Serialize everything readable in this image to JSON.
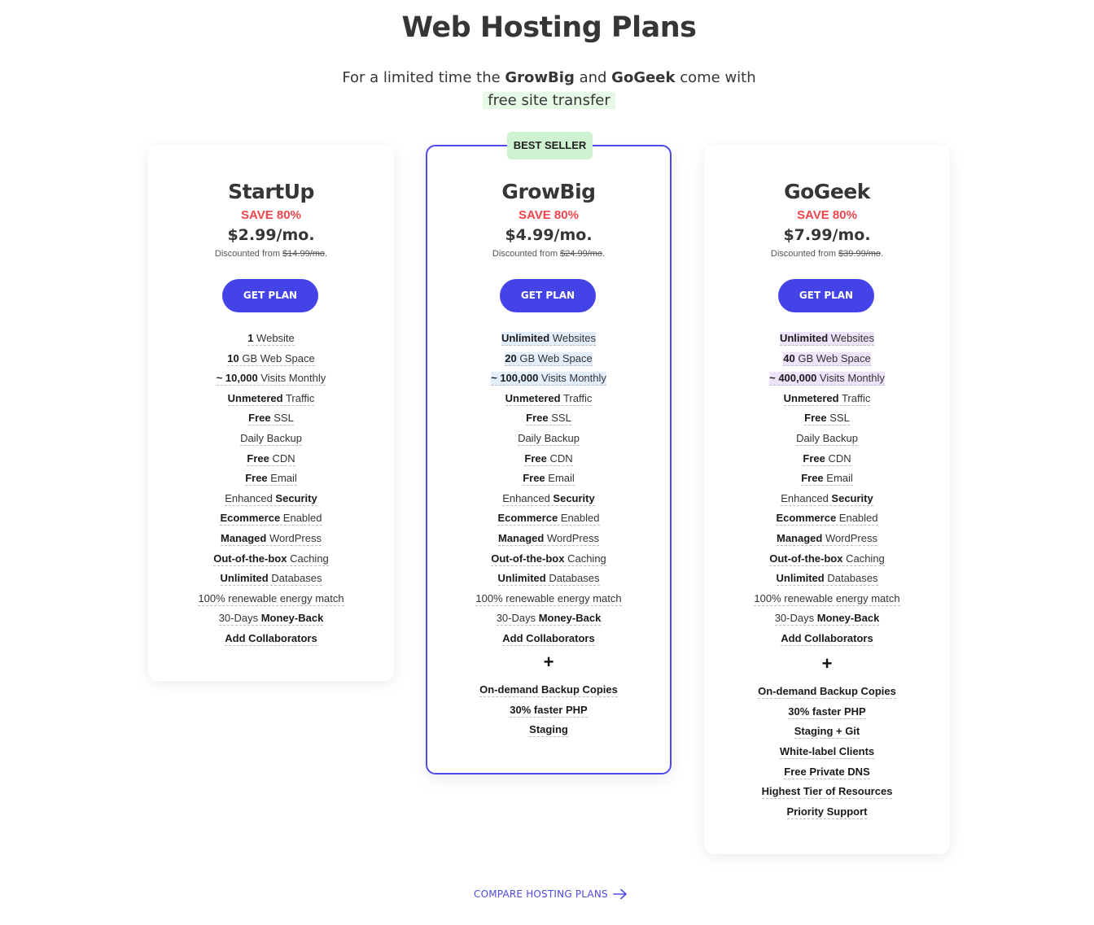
{
  "header": {
    "title": "Web Hosting Plans",
    "subtitle_prefix": "For a limited time the",
    "subtitle_plan1": "GrowBig",
    "subtitle_and": "and",
    "subtitle_plan2": "GoGeek",
    "subtitle_suffix": "come with",
    "subtitle_highlight": "free site transfer"
  },
  "colors": {
    "accent": "#4343e8",
    "save_red": "#f0454a",
    "best_seller_bg": "#cff2d1",
    "highlight_green": "#e6f8e6",
    "highlight_blue": "#e3eefc",
    "highlight_purple": "#efe3fb"
  },
  "plans": [
    {
      "name": "StartUp",
      "save": "SAVE 80%",
      "price": "$2.99/mo.",
      "discount_label": "Discounted from",
      "original_price": "$14.99/mo",
      "button": "GET PLAN",
      "features": [
        {
          "bold": "1",
          "rest": " Website",
          "order": "bold-first"
        },
        {
          "bold": "10",
          "rest": " GB Web Space",
          "order": "bold-first"
        },
        {
          "bold": "~ 10,000",
          "rest": " Visits Monthly",
          "order": "bold-first"
        },
        {
          "bold": "Unmetered",
          "rest": " Traffic",
          "order": "bold-first"
        },
        {
          "bold": "Free",
          "rest": " SSL",
          "order": "bold-first"
        },
        {
          "bold": "",
          "rest": "Daily Backup",
          "order": "bold-first"
        },
        {
          "bold": "Free",
          "rest": " CDN",
          "order": "bold-first"
        },
        {
          "bold": "Free",
          "rest": " Email",
          "order": "bold-first"
        },
        {
          "bold": "Security",
          "rest": "Enhanced ",
          "order": "rest-first"
        },
        {
          "bold": "Ecommerce",
          "rest": " Enabled",
          "order": "bold-first"
        },
        {
          "bold": "Managed",
          "rest": " WordPress",
          "order": "bold-first"
        },
        {
          "bold": "Out-of-the-box",
          "rest": " Caching",
          "order": "bold-first"
        },
        {
          "bold": "Unlimited",
          "rest": " Databases",
          "order": "bold-first"
        },
        {
          "bold": "",
          "rest": "100% renewable energy match",
          "order": "bold-first"
        },
        {
          "bold": "Money-Back",
          "rest": "30-Days ",
          "order": "rest-first"
        },
        {
          "bold": "Add Collaborators",
          "rest": "",
          "order": "bold-first"
        }
      ],
      "extras": []
    },
    {
      "name": "GrowBig",
      "badge": "BEST SELLER",
      "save": "SAVE 80%",
      "price": "$4.99/mo.",
      "discount_label": "Discounted from",
      "original_price": "$24.99/mo",
      "button": "GET PLAN",
      "features": [
        {
          "bold": "Unlimited",
          "rest": " Websites",
          "order": "bold-first",
          "highlight": "blue"
        },
        {
          "bold": "20",
          "rest": " GB Web Space",
          "order": "bold-first",
          "highlight": "blue"
        },
        {
          "bold": "~ 100,000",
          "rest": " Visits Monthly",
          "order": "bold-first",
          "highlight": "blue"
        },
        {
          "bold": "Unmetered",
          "rest": " Traffic",
          "order": "bold-first"
        },
        {
          "bold": "Free",
          "rest": " SSL",
          "order": "bold-first"
        },
        {
          "bold": "",
          "rest": "Daily Backup",
          "order": "bold-first"
        },
        {
          "bold": "Free",
          "rest": " CDN",
          "order": "bold-first"
        },
        {
          "bold": "Free",
          "rest": " Email",
          "order": "bold-first"
        },
        {
          "bold": "Security",
          "rest": "Enhanced ",
          "order": "rest-first"
        },
        {
          "bold": "Ecommerce",
          "rest": " Enabled",
          "order": "bold-first"
        },
        {
          "bold": "Managed",
          "rest": " WordPress",
          "order": "bold-first"
        },
        {
          "bold": "Out-of-the-box",
          "rest": " Caching",
          "order": "bold-first"
        },
        {
          "bold": "Unlimited",
          "rest": " Databases",
          "order": "bold-first"
        },
        {
          "bold": "",
          "rest": "100% renewable energy match",
          "order": "bold-first"
        },
        {
          "bold": "Money-Back",
          "rest": "30-Days ",
          "order": "rest-first"
        },
        {
          "bold": "Add Collaborators",
          "rest": "",
          "order": "bold-first"
        }
      ],
      "plus": "+",
      "extras": [
        "On-demand Backup Copies",
        "30% faster PHP",
        "Staging"
      ]
    },
    {
      "name": "GoGeek",
      "save": "SAVE 80%",
      "price": "$7.99/mo.",
      "discount_label": "Discounted from",
      "original_price": "$39.99/mo",
      "button": "GET PLAN",
      "features": [
        {
          "bold": "Unlimited",
          "rest": " Websites",
          "order": "bold-first",
          "highlight": "purple"
        },
        {
          "bold": "40",
          "rest": " GB Web Space",
          "order": "bold-first",
          "highlight": "purple"
        },
        {
          "bold": "~ 400,000",
          "rest": " Visits Monthly",
          "order": "bold-first",
          "highlight": "purple"
        },
        {
          "bold": "Unmetered",
          "rest": " Traffic",
          "order": "bold-first"
        },
        {
          "bold": "Free",
          "rest": " SSL",
          "order": "bold-first"
        },
        {
          "bold": "",
          "rest": "Daily Backup",
          "order": "bold-first"
        },
        {
          "bold": "Free",
          "rest": " CDN",
          "order": "bold-first"
        },
        {
          "bold": "Free",
          "rest": " Email",
          "order": "bold-first"
        },
        {
          "bold": "Security",
          "rest": "Enhanced ",
          "order": "rest-first"
        },
        {
          "bold": "Ecommerce",
          "rest": " Enabled",
          "order": "bold-first"
        },
        {
          "bold": "Managed",
          "rest": " WordPress",
          "order": "bold-first"
        },
        {
          "bold": "Out-of-the-box",
          "rest": " Caching",
          "order": "bold-first"
        },
        {
          "bold": "Unlimited",
          "rest": " Databases",
          "order": "bold-first"
        },
        {
          "bold": "",
          "rest": "100% renewable energy match",
          "order": "bold-first"
        },
        {
          "bold": "Money-Back",
          "rest": "30-Days ",
          "order": "rest-first"
        },
        {
          "bold": "Add Collaborators",
          "rest": "",
          "order": "bold-first"
        }
      ],
      "plus": "+",
      "extras": [
        "On-demand Backup Copies",
        "30% faster PHP",
        "Staging + Git",
        "White-label Clients",
        "Free Private DNS",
        "Highest Tier of Resources",
        "Priority Support"
      ]
    }
  ],
  "footer": {
    "compare_label": "COMPARE HOSTING PLANS",
    "compare_icon": "arrow-right-icon"
  }
}
